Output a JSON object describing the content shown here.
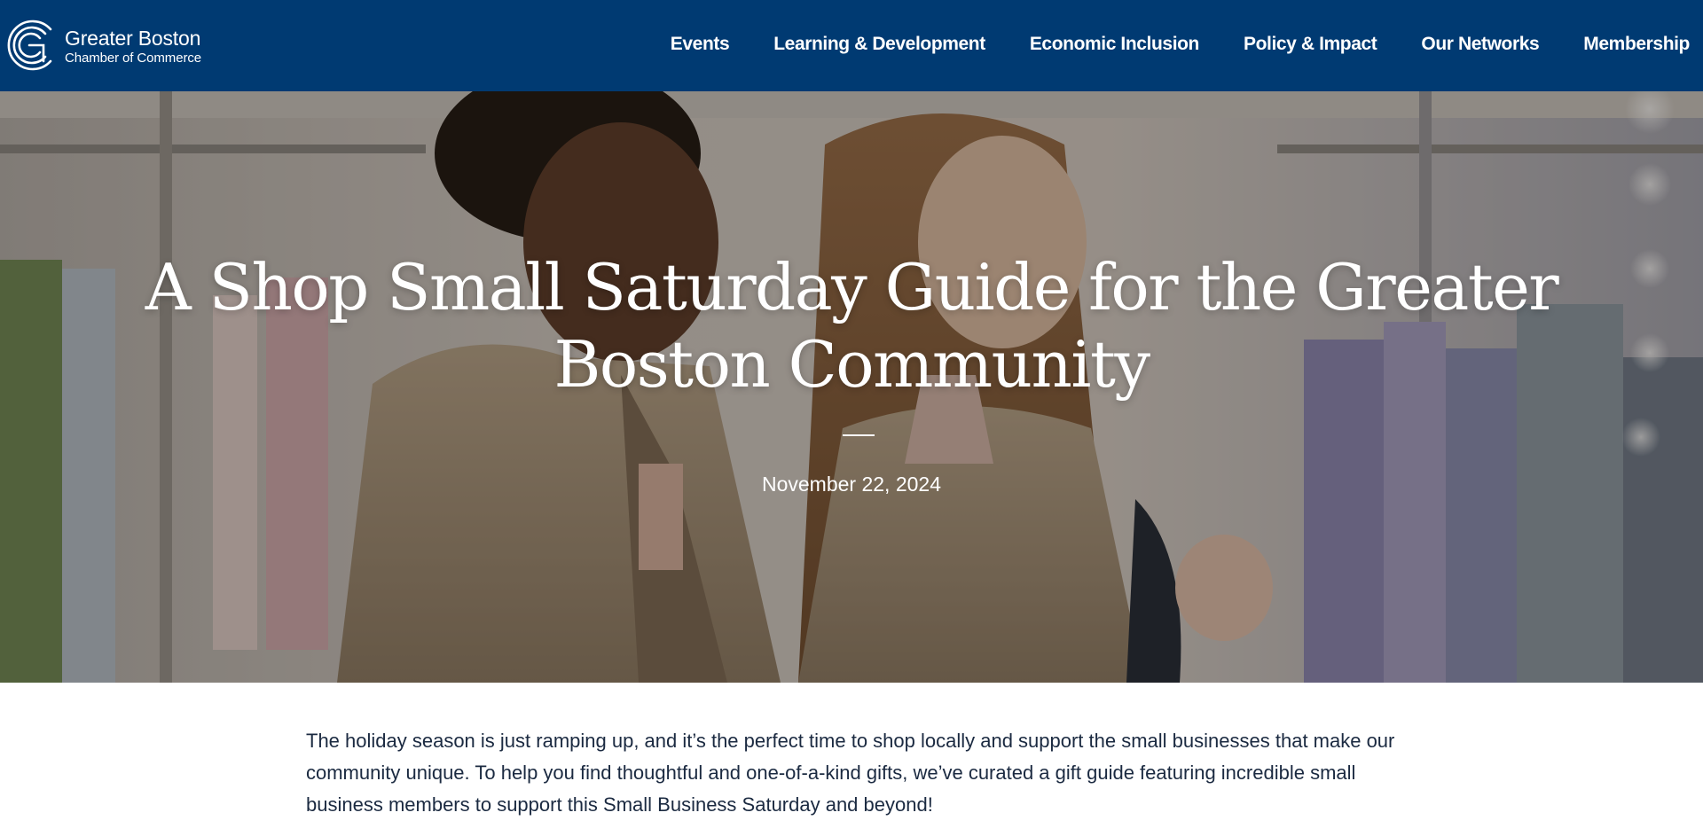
{
  "header": {
    "logo": {
      "line1": "Greater Boston",
      "line2": "Chamber of Commerce"
    },
    "nav": [
      {
        "label": "Events"
      },
      {
        "label": "Learning & Development"
      },
      {
        "label": "Economic Inclusion"
      },
      {
        "label": "Policy & Impact"
      },
      {
        "label": "Our Networks"
      },
      {
        "label": "Membership"
      }
    ]
  },
  "hero": {
    "title": "A Shop Small Saturday Guide for the Greater Boston Community",
    "date": "November 22, 2024"
  },
  "intro": {
    "text": "The holiday season is just ramping up, and it’s the perfect time to shop locally and support the small businesses that make our community unique. To help you find thoughtful and one-of-a-kind gifts, we’ve curated a gift guide featuring incredible small business members to support this Small Business Saturday and beyond!"
  },
  "colors": {
    "header_bg": "#003a72",
    "hero_text": "#ffffff",
    "body_text": "#1b2a41"
  }
}
